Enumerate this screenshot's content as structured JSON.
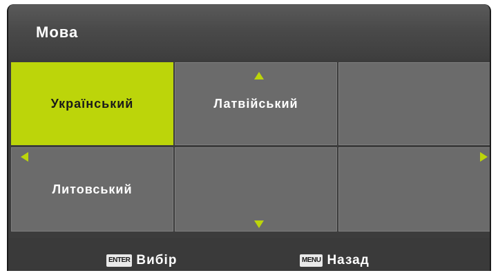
{
  "menu": {
    "title": "Мова"
  },
  "languages": [
    {
      "label": "Український",
      "selected": true
    },
    {
      "label": "Латвійський",
      "selected": false
    },
    {
      "label": "",
      "selected": false
    },
    {
      "label": "Литовський",
      "selected": false
    },
    {
      "label": "",
      "selected": false
    },
    {
      "label": "",
      "selected": false
    }
  ],
  "footer": {
    "select_key": "ENTER",
    "select_label": "Вибір",
    "back_key": "MENU",
    "back_label": "Назад"
  },
  "colors": {
    "accent": "#bcd50a",
    "cell": "#6b6b6b",
    "background": "#3c3c3c"
  },
  "icons": {
    "up": "arrow-up-icon",
    "down": "arrow-down-icon",
    "left": "arrow-left-icon",
    "right": "arrow-right-icon"
  }
}
